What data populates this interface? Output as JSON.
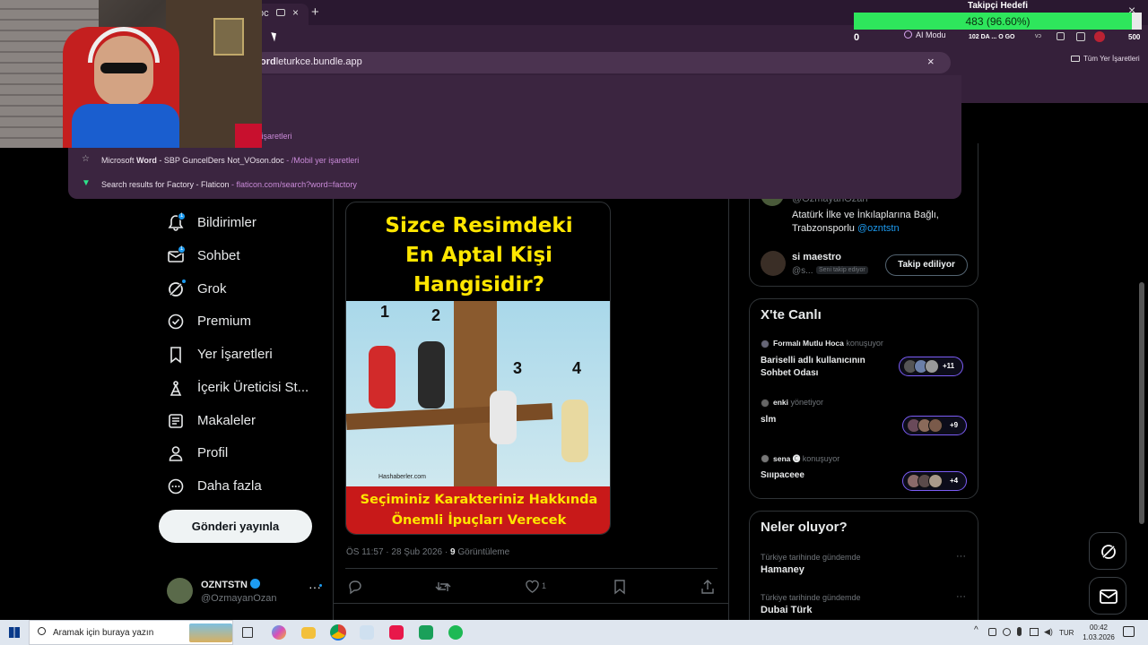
{
  "browser": {
    "tab_label": "oc",
    "omnibox_text_bold": "ord",
    "omnibox_text": "leturkce.bundle.app",
    "ai_mode_label": "AI Modu",
    "bookmarks_all_label": "Tüm Yer İşaretleri",
    "suggestions": [
      {
        "title_pre": "",
        "title_bold": "",
        "title_post": "",
        "url": "r işaretleri"
      },
      {
        "title_pre": "Microsoft ",
        "title_bold": "Word",
        "title_post": " - SBP GuncelDers Not_VOson.doc",
        "url": " - /Mobil yer işaretleri"
      },
      {
        "title_pre": "Search results for Factory - Flaticon",
        "title_bold": "",
        "title_post": "",
        "url": " - flaticon.com/search?word=factory"
      }
    ]
  },
  "overlay": {
    "goal_title": "Takipçi Hedefi",
    "goal_progress_text": "483 (96.60%)",
    "goal_progress": 0.966,
    "left_count": "0",
    "right_count": "500",
    "stream_label": "102 DA ... O GO"
  },
  "sidebar": {
    "items": [
      {
        "label": "Bildirimler",
        "badge": "1"
      },
      {
        "label": "Sohbet",
        "badge": "1"
      },
      {
        "label": "Grok"
      },
      {
        "label": "Premium"
      },
      {
        "label": "Yer İşaretleri"
      },
      {
        "label": "İçerik Üreticisi St..."
      },
      {
        "label": "Makaleler"
      },
      {
        "label": "Profil"
      },
      {
        "label": "Daha fazla"
      }
    ],
    "post_button": "Gönderi yayınla",
    "account_name": "OZNTSTN",
    "account_handle": "@OzmayanOzan"
  },
  "post": {
    "image_headline_1": "Sizce Resimdeki",
    "image_headline_2": "En Aptal Kişi",
    "image_headline_3": "Hangisidir?",
    "image_numbers": [
      "1",
      "2",
      "3",
      "4"
    ],
    "image_watermark": "Hashaberler.com",
    "image_footer_1": "Seçiminiz Karakteriniz Hakkında",
    "image_footer_2": "Önemli İpuçları Verecek",
    "meta": "ÖS 11:57 · 28 Şub 2026 · ",
    "views_count": "9",
    "views_label": " Görüntüleme",
    "like_count": "1"
  },
  "right": {
    "profile_handle": "@OzmayanOzan",
    "profile_bio": "Atatürk İlke ve İnkılaplarına Bağlı,",
    "profile_bio2_pre": "Trabzonsporlu ",
    "profile_bio2_link": "@ozntstn",
    "follow_user_name": "si maestro",
    "follow_user_handle": "@s...",
    "follow_user_badge": "Seni takip ediyor",
    "follow_button": "Takip ediliyor",
    "live_title": "X'te Canlı",
    "live_items": [
      {
        "host": "Formalı Mutlu Hoca",
        "role": " konuşuyor",
        "title1": "Bariselli adlı kullanıcının",
        "title2": "Sohbet Odası",
        "count": "+11"
      },
      {
        "host": "enki",
        "role": " yönetiyor",
        "title1": "slm",
        "title2": "",
        "count": "+9"
      },
      {
        "host": "sena 🅒",
        "role": " konuşuyor",
        "title1": "Sıııpaceee",
        "title2": "",
        "count": "+4"
      }
    ],
    "trends_title": "Neler oluyor?",
    "trends": [
      {
        "context": "Türkiye tarihinde gündemde",
        "name": "Hamaney"
      },
      {
        "context": "Türkiye tarihinde gündemde",
        "name": "Dubai Türk"
      }
    ]
  },
  "taskbar": {
    "search_placeholder": "Aramak için buraya yazın",
    "lang": "TUR",
    "time": "00:42",
    "date": "1.03.2026"
  },
  "colors": {
    "accent": "#1d9bf0",
    "browser_frame": "#35203a",
    "goal_bar": "#2ee65c",
    "live_border": "#7b5cf5"
  }
}
